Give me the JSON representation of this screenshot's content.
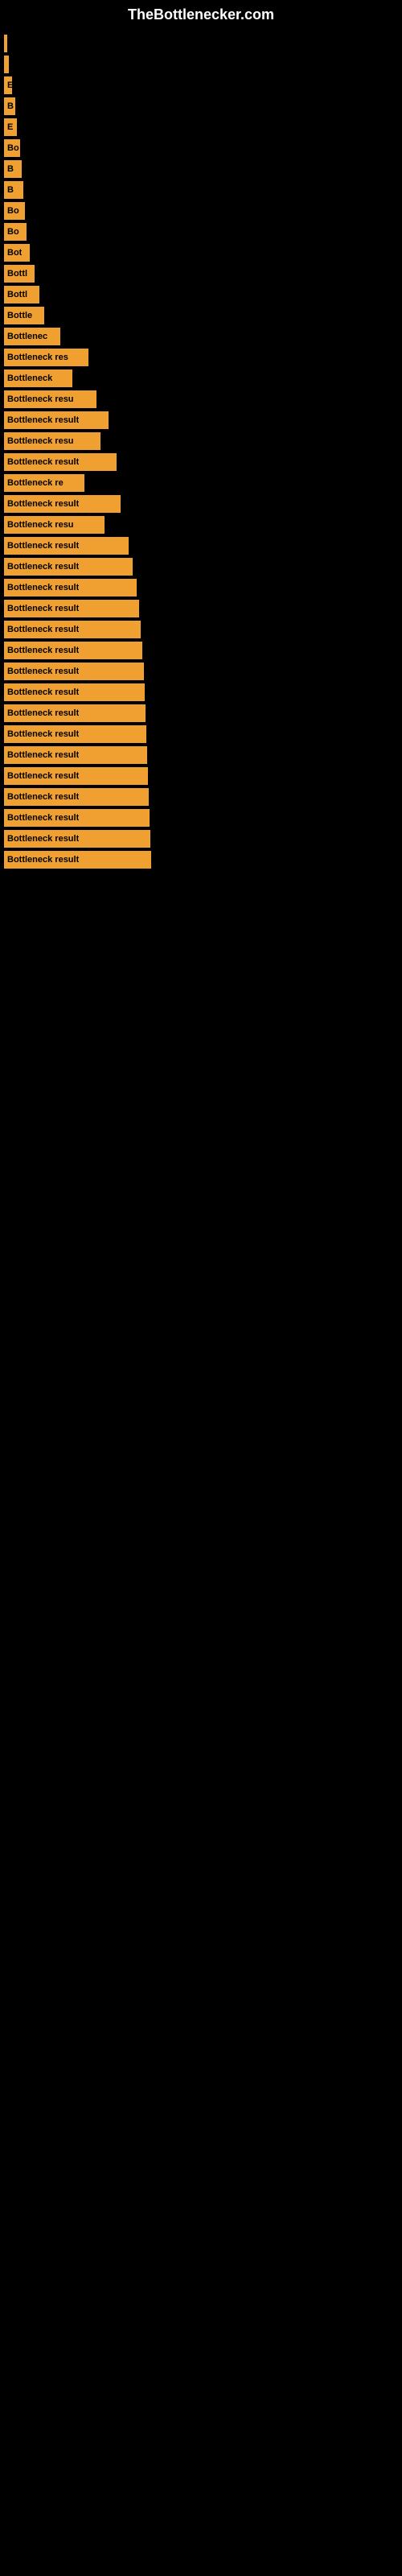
{
  "site": {
    "title": "TheBottlenecker.com"
  },
  "bars": [
    {
      "label": "",
      "width": 4
    },
    {
      "label": "",
      "width": 6
    },
    {
      "label": "E",
      "width": 10
    },
    {
      "label": "B",
      "width": 14
    },
    {
      "label": "E",
      "width": 16
    },
    {
      "label": "Bo",
      "width": 20
    },
    {
      "label": "B",
      "width": 22
    },
    {
      "label": "B",
      "width": 24
    },
    {
      "label": "Bo",
      "width": 26
    },
    {
      "label": "Bo",
      "width": 28
    },
    {
      "label": "Bot",
      "width": 32
    },
    {
      "label": "Bottl",
      "width": 38
    },
    {
      "label": "Bottl",
      "width": 44
    },
    {
      "label": "Bottle",
      "width": 50
    },
    {
      "label": "Bottlenec",
      "width": 70
    },
    {
      "label": "Bottleneck res",
      "width": 105
    },
    {
      "label": "Bottleneck",
      "width": 85
    },
    {
      "label": "Bottleneck resu",
      "width": 115
    },
    {
      "label": "Bottleneck result",
      "width": 130
    },
    {
      "label": "Bottleneck resu",
      "width": 120
    },
    {
      "label": "Bottleneck result",
      "width": 140
    },
    {
      "label": "Bottleneck re",
      "width": 100
    },
    {
      "label": "Bottleneck result",
      "width": 145
    },
    {
      "label": "Bottleneck resu",
      "width": 125
    },
    {
      "label": "Bottleneck result",
      "width": 155
    },
    {
      "label": "Bottleneck result",
      "width": 160
    },
    {
      "label": "Bottleneck result",
      "width": 165
    },
    {
      "label": "Bottleneck result",
      "width": 168
    },
    {
      "label": "Bottleneck result",
      "width": 170
    },
    {
      "label": "Bottleneck result",
      "width": 172
    },
    {
      "label": "Bottleneck result",
      "width": 174
    },
    {
      "label": "Bottleneck result",
      "width": 175
    },
    {
      "label": "Bottleneck result",
      "width": 176
    },
    {
      "label": "Bottleneck result",
      "width": 177
    },
    {
      "label": "Bottleneck result",
      "width": 178
    },
    {
      "label": "Bottleneck result",
      "width": 179
    },
    {
      "label": "Bottleneck result",
      "width": 180
    },
    {
      "label": "Bottleneck result",
      "width": 181
    },
    {
      "label": "Bottleneck result",
      "width": 182
    },
    {
      "label": "Bottleneck result",
      "width": 183
    }
  ]
}
